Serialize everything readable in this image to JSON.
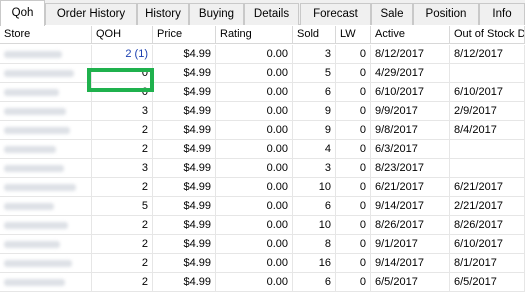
{
  "tabs": [
    {
      "label": "Qoh",
      "active": true
    },
    {
      "label": "Order History",
      "active": false
    },
    {
      "label": "History",
      "active": false
    },
    {
      "label": "Buying",
      "active": false
    },
    {
      "label": "Details",
      "active": false
    },
    {
      "label": "Forecast",
      "active": false
    },
    {
      "label": "Sale",
      "active": false
    },
    {
      "label": "Position",
      "active": false
    },
    {
      "label": "Info",
      "active": false
    }
  ],
  "table": {
    "columns": [
      "Store",
      "QOH",
      "Price",
      "Rating",
      "Sold",
      "LW",
      "Active",
      "Out of Stock D"
    ],
    "rows": [
      {
        "qoh": "2 (1)",
        "price": "$4.99",
        "rating": "0.00",
        "sold": "3",
        "lw": "0",
        "active": "8/12/2017",
        "oos": "8/12/2017"
      },
      {
        "qoh": "0",
        "price": "$4.99",
        "rating": "0.00",
        "sold": "5",
        "lw": "0",
        "active": "4/29/2017",
        "oos": ""
      },
      {
        "qoh": "0",
        "price": "$4.99",
        "rating": "0.00",
        "sold": "6",
        "lw": "0",
        "active": "6/10/2017",
        "oos": "6/10/2017"
      },
      {
        "qoh": "3",
        "price": "$4.99",
        "rating": "0.00",
        "sold": "9",
        "lw": "0",
        "active": "9/9/2017",
        "oos": "2/9/2017"
      },
      {
        "qoh": "2",
        "price": "$4.99",
        "rating": "0.00",
        "sold": "9",
        "lw": "0",
        "active": "9/8/2017",
        "oos": "8/4/2017"
      },
      {
        "qoh": "2",
        "price": "$4.99",
        "rating": "0.00",
        "sold": "4",
        "lw": "0",
        "active": "6/3/2017",
        "oos": ""
      },
      {
        "qoh": "3",
        "price": "$4.99",
        "rating": "0.00",
        "sold": "3",
        "lw": "0",
        "active": "8/23/2017",
        "oos": ""
      },
      {
        "qoh": "2",
        "price": "$4.99",
        "rating": "0.00",
        "sold": "10",
        "lw": "0",
        "active": "6/21/2017",
        "oos": "6/21/2017"
      },
      {
        "qoh": "5",
        "price": "$4.99",
        "rating": "0.00",
        "sold": "6",
        "lw": "0",
        "active": "9/14/2017",
        "oos": "2/21/2017"
      },
      {
        "qoh": "2",
        "price": "$4.99",
        "rating": "0.00",
        "sold": "10",
        "lw": "0",
        "active": "8/26/2017",
        "oos": "8/26/2017"
      },
      {
        "qoh": "2",
        "price": "$4.99",
        "rating": "0.00",
        "sold": "8",
        "lw": "0",
        "active": "9/1/2017",
        "oos": "6/10/2017"
      },
      {
        "qoh": "2",
        "price": "$4.99",
        "rating": "0.00",
        "sold": "16",
        "lw": "0",
        "active": "9/14/2017",
        "oos": "8/1/2017"
      },
      {
        "qoh": "2",
        "price": "$4.99",
        "rating": "0.00",
        "sold": "6",
        "lw": "0",
        "active": "6/5/2017",
        "oos": "6/5/2017"
      }
    ]
  },
  "colors": {
    "selection_border": "#1fb14d",
    "qoh_selected_text": "#1a3fb0"
  }
}
